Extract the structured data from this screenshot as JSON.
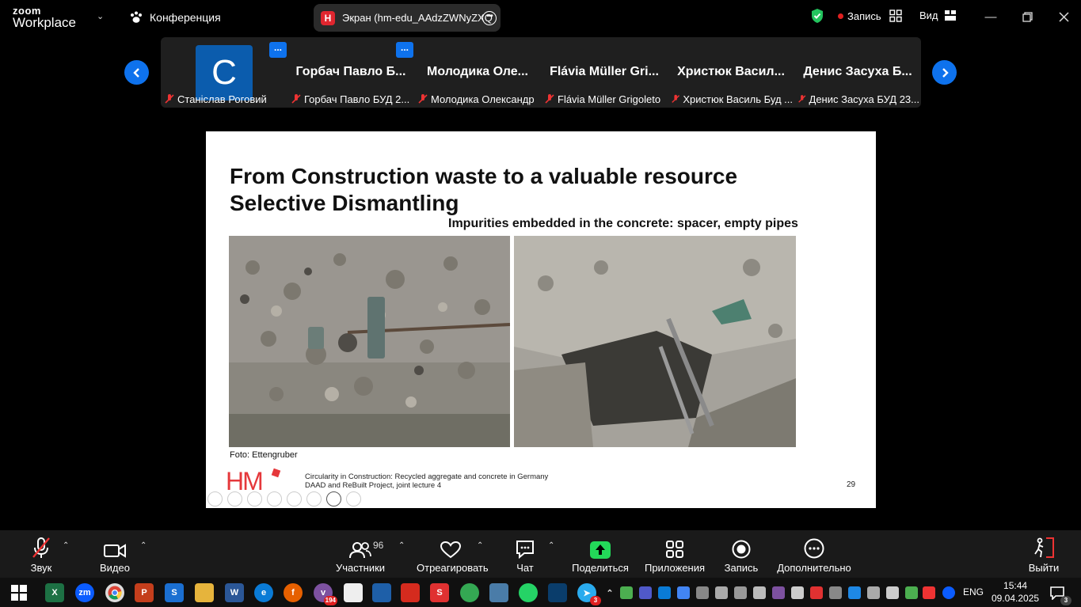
{
  "app": {
    "logo_line1": "zoom",
    "logo_line2": "Workplace"
  },
  "header": {
    "conference_label": "Конференция",
    "share_title": "Экран (hm-edu_AAdzZWNyZXQ",
    "share_app_letter": "H",
    "record_label": "Запись",
    "view_label": "Вид"
  },
  "participants": [
    {
      "tile_name": "",
      "label": "Станіслав Роговий",
      "avatar_letter": "C"
    },
    {
      "tile_name": "Горбач Павло Б...",
      "label": "Горбач Павло БУД 2..."
    },
    {
      "tile_name": "Молодика Оле...",
      "label": "Молодика Олександр"
    },
    {
      "tile_name": "Flávia Müller Gri...",
      "label": "Flávia Müller Grigoleto"
    },
    {
      "tile_name": "Христюк Васил...",
      "label": "Христюк Василь Буд ..."
    },
    {
      "tile_name": "Денис Засуха Б...",
      "label": "Денис Засуха БУД 23..."
    }
  ],
  "slide": {
    "title_line1": "From Construction waste to a valuable resource",
    "title_line2": "Selective Dismantling",
    "subtitle": "Impurities embedded in the concrete: spacer, empty pipes",
    "photo_credit": "Foto: Ettengruber",
    "logo_text": "HM",
    "footer_line1": "Circularity in Construction: Recycled aggregate and concrete in Germany",
    "footer_line2": "DAAD and ReBuilt Project, joint lecture 4",
    "page_number": "29"
  },
  "toolbar": {
    "audio": "Звук",
    "video": "Видео",
    "participants": "Участники",
    "participants_count": "96",
    "react": "Отреагировать",
    "chat": "Чат",
    "share": "Поделиться",
    "apps": "Приложения",
    "record": "Запись",
    "more": "Дополнительно",
    "leave": "Выйти"
  },
  "taskbar": {
    "language": "ENG",
    "time": "15:44",
    "date": "09.04.2025",
    "viber_badge": "194",
    "telegram_badge": "3",
    "notifications_badge": "3"
  },
  "colors": {
    "accent": "#0e72ed",
    "record_red": "#e02020",
    "share_green": "#23d959",
    "hm_red": "#e5383b"
  }
}
